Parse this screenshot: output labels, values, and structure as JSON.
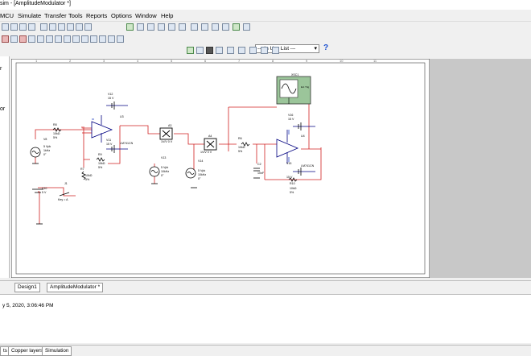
{
  "window": {
    "title": "sim - [AmplitudeModulator *]"
  },
  "menu": [
    "MCU",
    "Simulate",
    "Transfer",
    "Tools",
    "Reports",
    "Options",
    "Window",
    "Help"
  ],
  "toolbar": {
    "in_use_list": "--- In Use List ---",
    "help_label": "?"
  },
  "left_panel": [
    "r",
    "or"
  ],
  "schematic": {
    "ruler": [
      "1",
      "2",
      "3",
      "4",
      "5",
      "6",
      "7",
      "8",
      "9",
      "10",
      "11"
    ],
    "labels": [
      "V12",
      "15 V",
      "U3",
      "LM741CN",
      "V11",
      "15 V",
      "R8",
      "10kΩ",
      "5%",
      "V8",
      "5 Vpk",
      "1kHz",
      "0°",
      "R9",
      "10kΩ",
      "5%",
      "R7",
      "10kΩ",
      "5%",
      "V10",
      "5 V",
      "J1",
      "Key = A",
      "A3",
      "1V/V 0 V",
      "V13",
      "5 Vpk",
      "10kHz",
      "0°",
      "A4",
      "1V/V 0 V",
      "V14",
      "5 Vpk",
      "10kHz",
      "0°",
      "XSC1",
      "Ext Trig",
      "V16",
      "15 V",
      "U4",
      "LM741CN",
      "V15",
      "15 V",
      "R6",
      "10kΩ",
      "5%",
      "C2",
      "10nF",
      "R10",
      "10kΩ",
      "5%"
    ]
  },
  "tabs": [
    "Design1",
    "AmplitudeModulator *"
  ],
  "log": {
    "line": "y 5, 2020, 3:06:46 PM"
  },
  "bottom_tabs": [
    "ts",
    "Copper layers",
    "Simulation"
  ],
  "colors": {
    "wire_red": "#d02020",
    "wire_blue": "#2040c0",
    "component": "#000080"
  }
}
